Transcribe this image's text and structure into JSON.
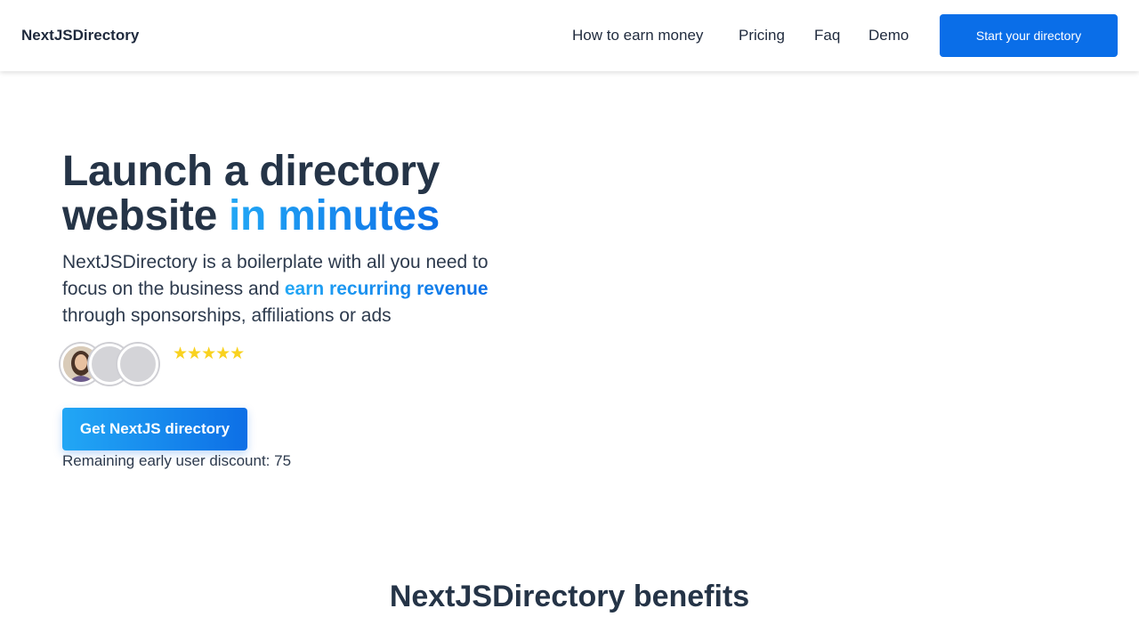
{
  "header": {
    "brand": "NextJSDirectory",
    "nav": [
      "How to earn money",
      "Pricing",
      "Faq",
      "Demo"
    ],
    "cta": "Start your directory"
  },
  "hero": {
    "title_line1": "Launch a directory",
    "title_line2_plain": "website ",
    "title_line2_accent": "in minutes",
    "subtitle_before": "NextJSDirectory is a boilerplate with all you need to focus on the business and ",
    "subtitle_highlight": "earn recurring revenue",
    "subtitle_after": " through sponsorships, affiliations or ads",
    "stars": "★★★★★",
    "rating": 5,
    "buy_button": "Get NextJS directory",
    "remaining_label": "Remaining early user discount: 75"
  },
  "benefits_title": "NextJSDirectory benefits",
  "colors": {
    "primary": "#0a6ee8",
    "gradient_start": "#22a7f5",
    "gradient_end": "#0d6fe6",
    "heading": "#253447",
    "star": "#f9d21f"
  },
  "icons": {
    "rating": "star-icon",
    "avatars": [
      "avatar-photo",
      "avatar-placeholder",
      "avatar-placeholder"
    ]
  }
}
